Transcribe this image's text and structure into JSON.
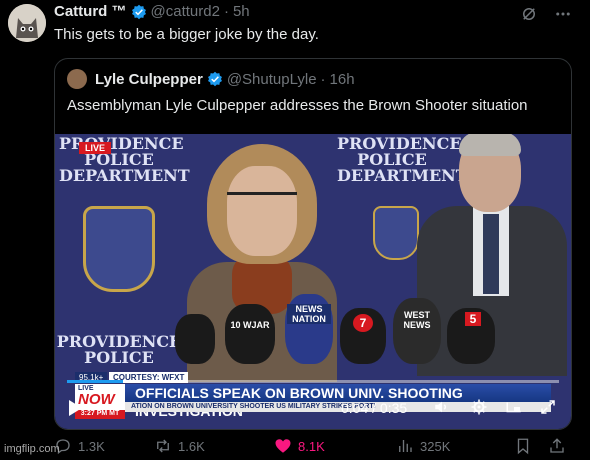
{
  "tweet": {
    "author": "Catturd ™",
    "handle": "@catturd2",
    "separator": "·",
    "time": "5h",
    "text": "This gets to be a bigger joke by the day."
  },
  "quote": {
    "author": "Lyle Culpepper",
    "handle": "@ShutupLyle",
    "separator": "·",
    "time": "16h",
    "text": "Assemblyman Lyle Culpepper addresses the Brown Shooter situation"
  },
  "video": {
    "backdrop_left": "PROVIDENCE\nPOLICE\nDEPARTMENT",
    "backdrop_right": "PROVIDENCE\nPOLICE\nDEPARTMENT",
    "backdrop_bottom": "PROVIDENCE\nPOLICE",
    "live_badge": "LIVE",
    "lower_third": {
      "temp": "95.1k+",
      "courtesy": "COURTESY: WFXT",
      "live_label": "LIVE",
      "now_label": "NOW",
      "headline": "OFFICIALS SPEAK ON BROWN UNIV. SHOOTING INVESTIGATION",
      "clock": "3:27 PM MT",
      "ticker": "ATION ON BROWN UNIVERSITY SHOOTER   US MILITARY STRIKES   PORTI"
    },
    "mic_labels": [
      "NEWS NATION",
      "10 WJAR",
      "7",
      "WEST NEWS",
      "5"
    ],
    "player": {
      "current_time": "0:04",
      "duration_sep": "/",
      "duration": "0:35",
      "progress": 0.114
    }
  },
  "actions": {
    "replies": "1.3K",
    "reposts": "1.6K",
    "likes": "8.1K",
    "views": "325K"
  },
  "watermark": "imgflip.com",
  "colors": {
    "background": "#000000",
    "text_primary": "#e7e9ea",
    "text_secondary": "#71767b",
    "verified_blue": "#1d9bf0",
    "like_pink": "#f91880"
  }
}
